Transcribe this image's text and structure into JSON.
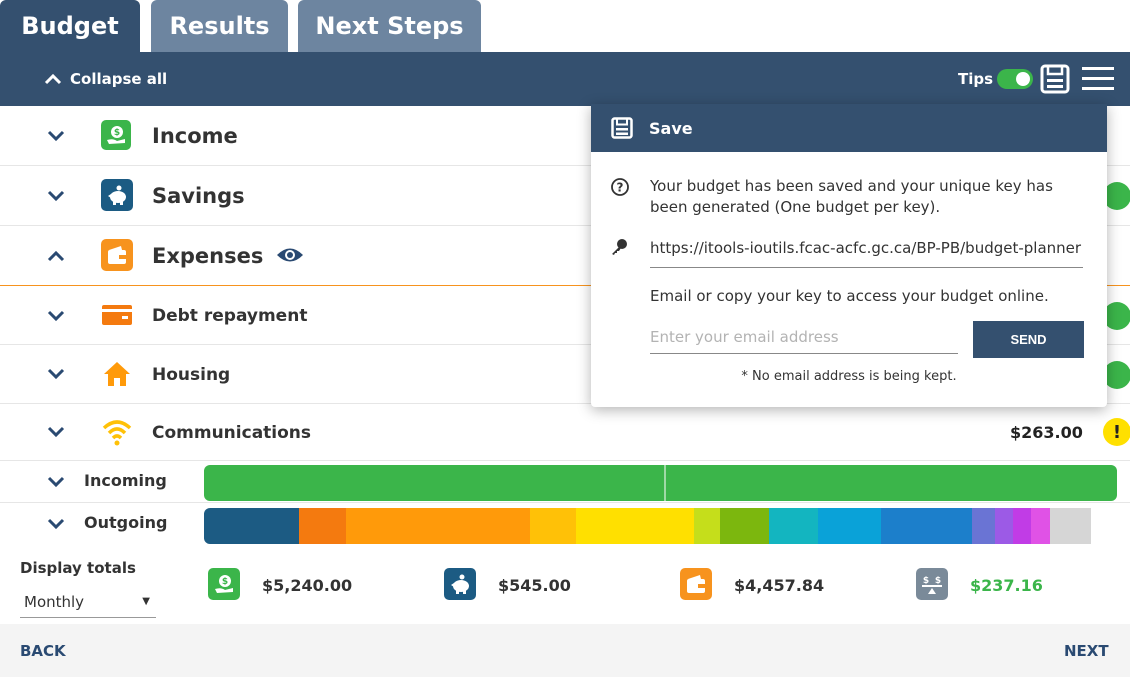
{
  "tabs": [
    {
      "label": "Budget"
    },
    {
      "label": "Results"
    },
    {
      "label": "Next Steps"
    }
  ],
  "toolbar": {
    "collapse_label": "Collapse all",
    "tips_label": "Tips",
    "tips_on": true
  },
  "categories": [
    {
      "label": "Income",
      "icon": "income-hand-coin-icon",
      "color": "#3bb54a",
      "expanded": false
    },
    {
      "label": "Savings",
      "icon": "piggy-bank-icon",
      "color": "#1c5b83",
      "expanded": false
    },
    {
      "label": "Expenses",
      "icon": "wallet-icon",
      "color": "#f7931e",
      "expanded": true
    }
  ],
  "expense_items": [
    {
      "label": "Debt repayment",
      "icon": "credit-card-icon",
      "value": ""
    },
    {
      "label": "Housing",
      "icon": "house-icon",
      "value": ""
    },
    {
      "label": "Communications",
      "icon": "wifi-icon",
      "value": "$263.00",
      "status": "warning"
    }
  ],
  "bars": {
    "incoming_label": "Incoming",
    "outgoing_label": "Outgoing",
    "incoming_color": "#3bb54a",
    "outgoing_segments": [
      {
        "color": "#1c5b83",
        "share": 0.104
      },
      {
        "color": "#f47a0f",
        "share": 0.052
      },
      {
        "color": "#ff9a0a",
        "share": 0.201
      },
      {
        "color": "#ffc107",
        "share": 0.05
      },
      {
        "color": "#ffe000",
        "share": 0.13
      },
      {
        "color": "#c5de1b",
        "share": 0.028
      },
      {
        "color": "#7cb70e",
        "share": 0.054
      },
      {
        "color": "#13b5c0",
        "share": 0.054
      },
      {
        "color": "#0aa2d8",
        "share": 0.069
      },
      {
        "color": "#1c7fcb",
        "share": 0.099
      },
      {
        "color": "#6a74d4",
        "share": 0.025
      },
      {
        "color": "#9c5ae6",
        "share": 0.02
      },
      {
        "color": "#c13ce6",
        "share": 0.02
      },
      {
        "color": "#e052e6",
        "share": 0.021
      },
      {
        "color": "#d6d6d6",
        "share": 0.045
      }
    ]
  },
  "totals": {
    "display_label": "Display totals",
    "period": "Monthly",
    "income": "$5,240.00",
    "savings": "$545.00",
    "expenses": "$4,457.84",
    "balance": "$237.16",
    "balance_color": "#3bb54a"
  },
  "footer": {
    "back": "BACK",
    "next": "NEXT"
  },
  "save_popup": {
    "title": "Save",
    "message": "Your budget has been saved and your unique key has been generated (One budget per key).",
    "url": "https://itools-ioutils.fcac-acfc.gc.ca/BP-PB/budget-planner",
    "instruction": "Email or copy your key to access your budget online.",
    "email_placeholder": "Enter your email address",
    "send_label": "SEND",
    "note": "* No email address is being kept."
  }
}
